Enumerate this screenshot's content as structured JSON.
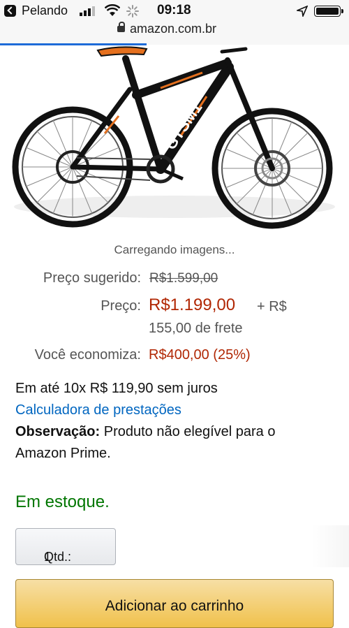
{
  "status_bar": {
    "carrier": "Pelando",
    "time": "09:18"
  },
  "url_bar": {
    "url": "amazon.com.br"
  },
  "image": {
    "loading_text": "Carregando imagens...",
    "brand_text": "GTSM1"
  },
  "pricing": {
    "suggested_label": "Preço sugerido:",
    "suggested_value": "R$1.599,00",
    "price_label": "Preço:",
    "price_value": "R$1.199,00",
    "shipping_part1": "+ R$",
    "shipping_part2": "155,00 de frete",
    "savings_label": "Você economiza:",
    "savings_value": "R$400,00 (25%)"
  },
  "payment": {
    "installments": "Em até 10x R$ 119,90 sem juros",
    "calculator_link": "Calculadora de prestações",
    "note_label": "Observação:",
    "note_line1": " Produto não elegível para o",
    "note_line2": "Amazon Prime."
  },
  "availability": "Em estoque.",
  "quantity": {
    "label": "Qtd.:",
    "value": "1"
  },
  "add_to_cart": "Adicionar ao carrinho",
  "colors": {
    "price_red": "#b12704",
    "stock_green": "#007600",
    "link_blue": "#0066c0",
    "cart_button": "#f0c14b"
  }
}
